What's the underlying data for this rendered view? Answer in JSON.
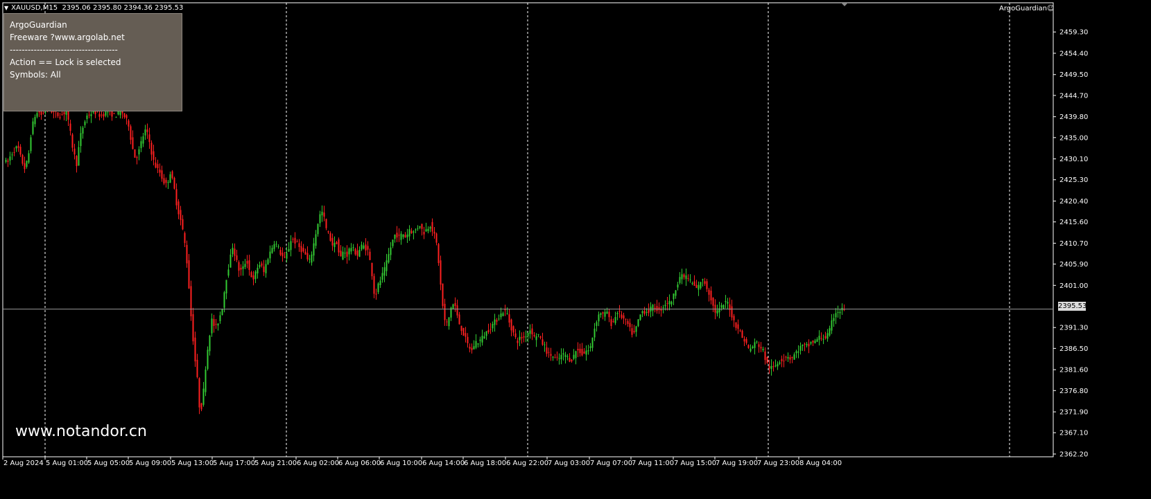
{
  "header": {
    "symbol": "XAUUSD,M15",
    "ohlc": "2395.06 2395.80 2394.36 2395.53"
  },
  "ea": {
    "label": "ArgoGuardian",
    "smiley": "☺"
  },
  "info_panel": {
    "lines": [
      "ArgoGuardian",
      "Freeware ?www.argolab.net",
      "------------------------------------",
      "Action == Lock is selected",
      "Symbols: All"
    ]
  },
  "watermark": "www.notandor.cn",
  "price_axis": {
    "current": "2395.53",
    "ticks": [
      "2459.30",
      "2454.40",
      "2449.50",
      "2444.70",
      "2439.80",
      "2435.00",
      "2430.10",
      "2425.30",
      "2420.40",
      "2415.60",
      "2410.70",
      "2405.90",
      "2401.00",
      "2391.30",
      "2386.50",
      "2381.60",
      "2376.80",
      "2371.90",
      "2367.10",
      "2362.20"
    ]
  },
  "time_axis": {
    "labels": [
      "2 Aug 2024",
      "5 Aug 01:00",
      "5 Aug 05:00",
      "5 Aug 09:00",
      "5 Aug 13:00",
      "5 Aug 17:00",
      "5 Aug 21:00",
      "6 Aug 02:00",
      "6 Aug 06:00",
      "6 Aug 10:00",
      "6 Aug 14:00",
      "6 Aug 18:00",
      "6 Aug 22:00",
      "7 Aug 03:00",
      "7 Aug 07:00",
      "7 Aug 11:00",
      "7 Aug 15:00",
      "7 Aug 19:00",
      "7 Aug 23:00",
      "8 Aug 04:00"
    ]
  },
  "colors": {
    "bull": "#33cc33",
    "bear": "#ff2020",
    "background": "#000000",
    "grid": "#ffffff"
  },
  "chart_data": {
    "type": "candlestick",
    "symbol": "XAUUSD",
    "timeframe": "M15",
    "ylim": [
      2362.2,
      2460.5
    ],
    "current_price": 2395.53,
    "path": [
      [
        0,
        2430
      ],
      [
        5,
        2429
      ],
      [
        10,
        2431
      ],
      [
        15,
        2432
      ],
      [
        20,
        2433
      ],
      [
        25,
        2430
      ],
      [
        30,
        2428
      ],
      [
        35,
        2430
      ],
      [
        40,
        2437
      ],
      [
        45,
        2440
      ],
      [
        50,
        2441
      ],
      [
        55,
        2440
      ],
      [
        60,
        2442
      ],
      [
        70,
        2441
      ],
      [
        80,
        2440
      ],
      [
        90,
        2441
      ],
      [
        95,
        2437
      ],
      [
        100,
        2432
      ],
      [
        105,
        2429
      ],
      [
        110,
        2435
      ],
      [
        115,
        2438
      ],
      [
        120,
        2440
      ],
      [
        130,
        2441
      ],
      [
        140,
        2440
      ],
      [
        150,
        2441
      ],
      [
        160,
        2440
      ],
      [
        170,
        2441
      ],
      [
        180,
        2438
      ],
      [
        185,
        2433
      ],
      [
        190,
        2430
      ],
      [
        195,
        2432
      ],
      [
        200,
        2435
      ],
      [
        205,
        2437
      ],
      [
        210,
        2434
      ],
      [
        215,
        2430
      ],
      [
        220,
        2428
      ],
      [
        225,
        2427
      ],
      [
        230,
        2425
      ],
      [
        235,
        2424
      ],
      [
        240,
        2427
      ],
      [
        245,
        2424
      ],
      [
        250,
        2419
      ],
      [
        255,
        2416
      ],
      [
        260,
        2412
      ],
      [
        265,
        2405
      ],
      [
        270,
        2394
      ],
      [
        275,
        2385
      ],
      [
        280,
        2378
      ],
      [
        283,
        2371
      ],
      [
        287,
        2375
      ],
      [
        292,
        2384
      ],
      [
        297,
        2390
      ],
      [
        300,
        2393
      ],
      [
        305,
        2391
      ],
      [
        310,
        2393
      ],
      [
        315,
        2396
      ],
      [
        320,
        2402
      ],
      [
        325,
        2406
      ],
      [
        330,
        2410
      ],
      [
        335,
        2407
      ],
      [
        340,
        2404
      ],
      [
        345,
        2405
      ],
      [
        350,
        2407
      ],
      [
        355,
        2404
      ],
      [
        360,
        2402
      ],
      [
        365,
        2405
      ],
      [
        370,
        2406
      ],
      [
        375,
        2404
      ],
      [
        380,
        2407
      ],
      [
        385,
        2409
      ],
      [
        390,
        2411
      ],
      [
        395,
        2410
      ],
      [
        400,
        2408
      ],
      [
        405,
        2407
      ],
      [
        410,
        2409
      ],
      [
        415,
        2412
      ],
      [
        420,
        2411
      ],
      [
        425,
        2410
      ],
      [
        430,
        2409
      ],
      [
        435,
        2408
      ],
      [
        440,
        2406
      ],
      [
        445,
        2409
      ],
      [
        450,
        2413
      ],
      [
        455,
        2417
      ],
      [
        460,
        2418
      ],
      [
        465,
        2414
      ],
      [
        470,
        2412
      ],
      [
        475,
        2410
      ],
      [
        480,
        2411
      ],
      [
        485,
        2407
      ],
      [
        490,
        2409
      ],
      [
        495,
        2408
      ],
      [
        500,
        2410
      ],
      [
        505,
        2409
      ],
      [
        510,
        2408
      ],
      [
        515,
        2410
      ],
      [
        520,
        2410
      ],
      [
        525,
        2409
      ],
      [
        530,
        2405
      ],
      [
        535,
        2398
      ],
      [
        540,
        2401
      ],
      [
        545,
        2403
      ],
      [
        550,
        2405
      ],
      [
        555,
        2408
      ],
      [
        560,
        2411
      ],
      [
        565,
        2413
      ],
      [
        570,
        2412
      ],
      [
        575,
        2413
      ],
      [
        580,
        2412
      ],
      [
        585,
        2414
      ],
      [
        590,
        2413
      ],
      [
        595,
        2414
      ],
      [
        600,
        2415
      ],
      [
        605,
        2413
      ],
      [
        610,
        2414
      ],
      [
        615,
        2415
      ],
      [
        620,
        2413
      ],
      [
        625,
        2410
      ],
      [
        630,
        2401
      ],
      [
        635,
        2393
      ],
      [
        640,
        2392
      ],
      [
        645,
        2396
      ],
      [
        650,
        2397
      ],
      [
        655,
        2393
      ],
      [
        660,
        2391
      ],
      [
        665,
        2389
      ],
      [
        670,
        2387
      ],
      [
        675,
        2386
      ],
      [
        680,
        2388
      ],
      [
        685,
        2388
      ],
      [
        690,
        2389
      ],
      [
        695,
        2390
      ],
      [
        700,
        2391
      ],
      [
        705,
        2392
      ],
      [
        710,
        2393
      ],
      [
        715,
        2394
      ],
      [
        720,
        2395
      ],
      [
        725,
        2395
      ],
      [
        730,
        2392
      ],
      [
        735,
        2390
      ],
      [
        740,
        2388
      ],
      [
        745,
        2389
      ],
      [
        750,
        2389
      ],
      [
        755,
        2390
      ],
      [
        760,
        2391
      ],
      [
        765,
        2389
      ],
      [
        770,
        2390
      ],
      [
        775,
        2388
      ],
      [
        780,
        2387
      ],
      [
        785,
        2385
      ],
      [
        790,
        2385
      ],
      [
        795,
        2384
      ],
      [
        800,
        2384
      ],
      [
        805,
        2385
      ],
      [
        810,
        2385
      ],
      [
        815,
        2384
      ],
      [
        820,
        2384
      ],
      [
        825,
        2386
      ],
      [
        830,
        2386
      ],
      [
        835,
        2385
      ],
      [
        840,
        2386
      ],
      [
        845,
        2386
      ],
      [
        850,
        2390
      ],
      [
        855,
        2393
      ],
      [
        860,
        2395
      ],
      [
        865,
        2394
      ],
      [
        870,
        2395
      ],
      [
        875,
        2392
      ],
      [
        880,
        2393
      ],
      [
        885,
        2395
      ],
      [
        890,
        2394
      ],
      [
        895,
        2393
      ],
      [
        900,
        2392
      ],
      [
        905,
        2390
      ],
      [
        910,
        2390
      ],
      [
        915,
        2393
      ],
      [
        920,
        2395
      ],
      [
        925,
        2395
      ],
      [
        930,
        2395
      ],
      [
        935,
        2396
      ],
      [
        940,
        2396
      ],
      [
        945,
        2395
      ],
      [
        950,
        2396
      ],
      [
        955,
        2397
      ],
      [
        960,
        2397
      ],
      [
        965,
        2398
      ],
      [
        970,
        2401
      ],
      [
        975,
        2403
      ],
      [
        980,
        2403
      ],
      [
        985,
        2403
      ],
      [
        990,
        2402
      ],
      [
        995,
        2401
      ],
      [
        1000,
        2400
      ],
      [
        1005,
        2402
      ],
      [
        1010,
        2402
      ],
      [
        1015,
        2400
      ],
      [
        1020,
        2398
      ],
      [
        1025,
        2395
      ],
      [
        1030,
        2395
      ],
      [
        1035,
        2396
      ],
      [
        1040,
        2397
      ],
      [
        1045,
        2397
      ],
      [
        1050,
        2394
      ],
      [
        1055,
        2392
      ],
      [
        1060,
        2391
      ],
      [
        1065,
        2389
      ],
      [
        1070,
        2388
      ],
      [
        1075,
        2386
      ],
      [
        1080,
        2387
      ],
      [
        1085,
        2388
      ],
      [
        1090,
        2387
      ],
      [
        1095,
        2386
      ],
      [
        1100,
        2383
      ],
      [
        1105,
        2382
      ],
      [
        1110,
        2382
      ],
      [
        1115,
        2383
      ],
      [
        1120,
        2384
      ],
      [
        1125,
        2384
      ],
      [
        1130,
        2385
      ],
      [
        1135,
        2384
      ],
      [
        1140,
        2385
      ],
      [
        1145,
        2386
      ],
      [
        1150,
        2387
      ],
      [
        1155,
        2387
      ],
      [
        1160,
        2387
      ],
      [
        1165,
        2388
      ],
      [
        1170,
        2388
      ],
      [
        1175,
        2389
      ],
      [
        1180,
        2389
      ],
      [
        1185,
        2389
      ],
      [
        1190,
        2390
      ],
      [
        1195,
        2393
      ],
      [
        1200,
        2395
      ],
      [
        1205,
        2395
      ],
      [
        1210,
        2395.53
      ]
    ]
  }
}
